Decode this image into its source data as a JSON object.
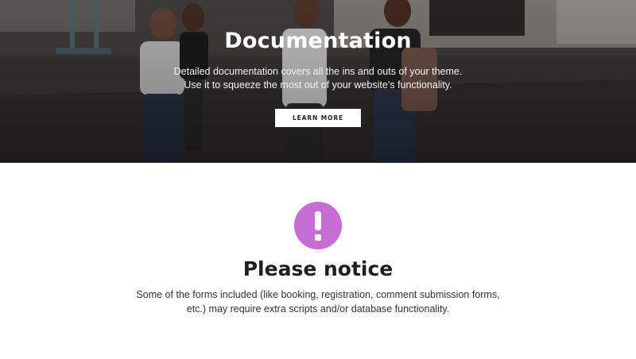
{
  "hero": {
    "title": "Documentation",
    "description_line1": "Detailed documentation covers all the ins and outs of your theme.",
    "description_line2": "Use it to squeeze the most out of your website’s functionality.",
    "button_label": "LEARN MORE",
    "image": "photo of four young women walking outdoors in a parking lot"
  },
  "notice": {
    "icon": "exclamation-icon",
    "icon_color": "#c66dd4",
    "title": "Please notice",
    "text_line1": "Some of the forms included (like booking, registration, comment submission forms,",
    "text_line2": "etc.) may require extra scripts and/or database functionality."
  }
}
